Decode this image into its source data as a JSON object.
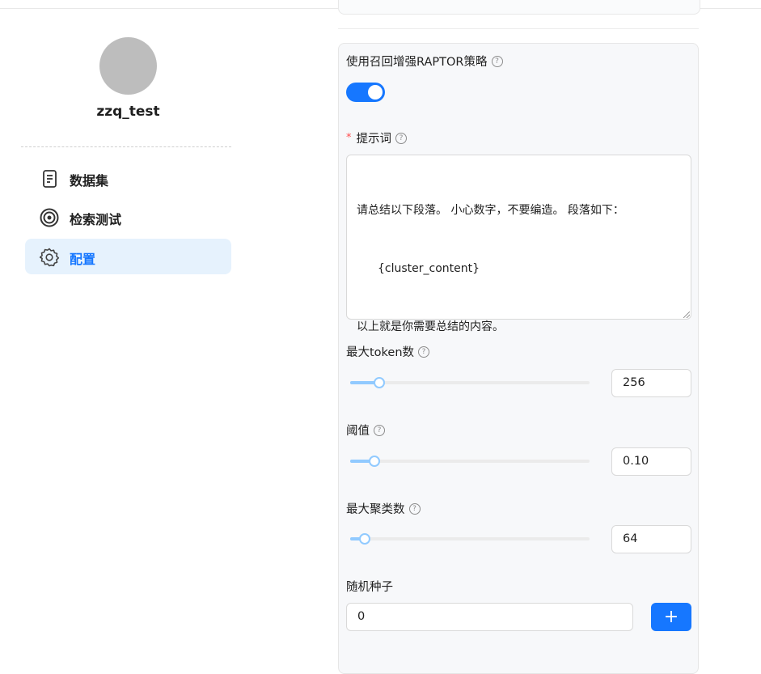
{
  "user": {
    "name": "zzq_test"
  },
  "sidebar": {
    "items": [
      {
        "label": "数据集",
        "icon": "dataset-icon"
      },
      {
        "label": "检索测试",
        "icon": "target-icon"
      },
      {
        "label": "配置",
        "icon": "gear-icon",
        "active": true
      }
    ]
  },
  "raptor": {
    "toggle_label": "使用召回增强RAPTOR策略",
    "enabled": true,
    "prompt_label": "提示词",
    "prompt_lines": [
      "请总结以下段落。 小心数字，不要编造。 段落如下：",
      "{cluster_content}",
      "以上就是你需要总结的内容。"
    ],
    "max_token": {
      "label": "最大token数",
      "value": "256",
      "fraction": 0.12
    },
    "threshold": {
      "label": "阈值",
      "value": "0.10",
      "fraction": 0.1
    },
    "max_cluster": {
      "label": "最大聚类数",
      "value": "64",
      "fraction": 0.06
    },
    "seed": {
      "label": "随机种子",
      "value": "0",
      "button": "+"
    }
  },
  "colors": {
    "accent": "#1677ff",
    "slider": "#91caff",
    "active_bg": "#e6f2fd"
  }
}
